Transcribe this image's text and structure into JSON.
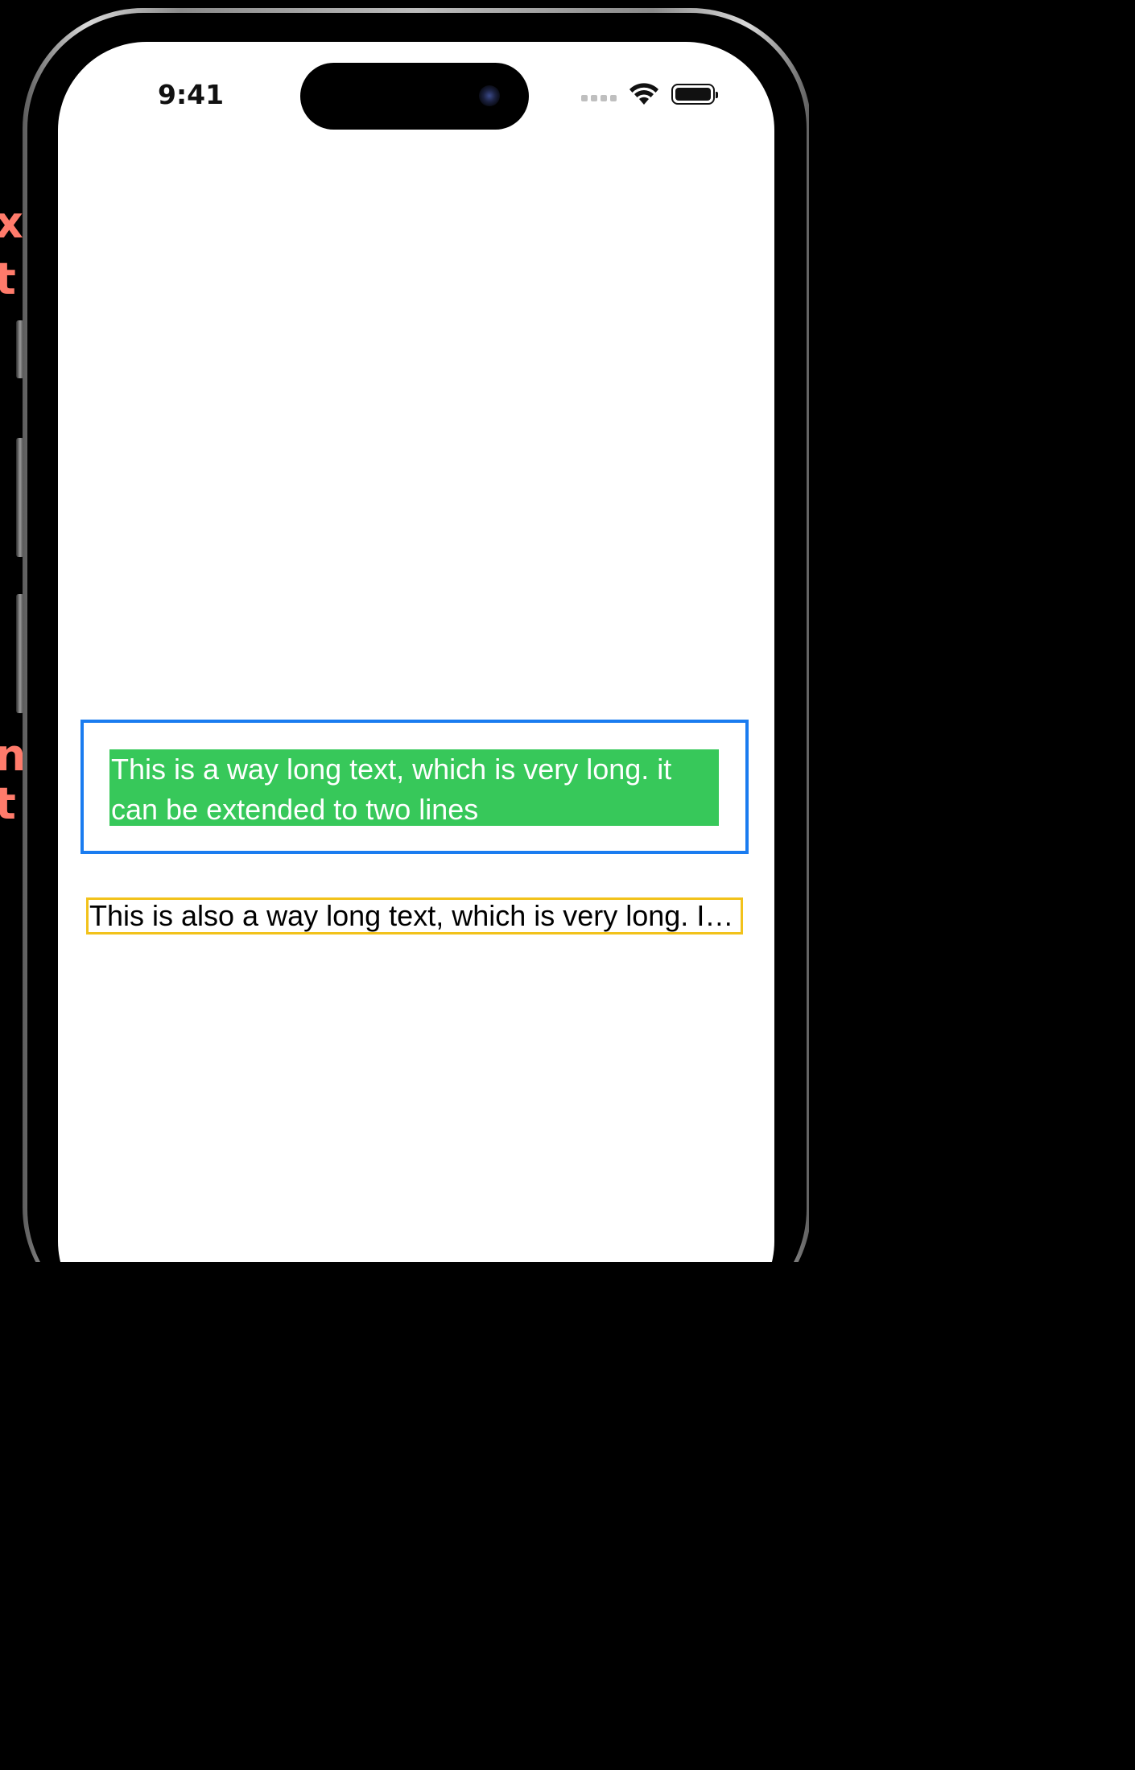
{
  "status_bar": {
    "time": "9:41",
    "icons": [
      "signal-icon",
      "wifi-icon",
      "battery-icon"
    ]
  },
  "background_edge_text": {
    "line1": "xt",
    "line2": "t",
    "line3": "ng",
    "line4": "t"
  },
  "content": {
    "multiline_label": "This is a way long text, which is very long. it can be extended to two lines",
    "truncated_label": "This is also a way long text, which is very long. It should be truncated"
  },
  "colors": {
    "background": "#000000",
    "screen": "#ffffff",
    "blue_border": "#1a7cf0",
    "green_fill": "#37c85a",
    "yellow_border": "#f2c21b",
    "edge_text": "#ff7b6b"
  }
}
